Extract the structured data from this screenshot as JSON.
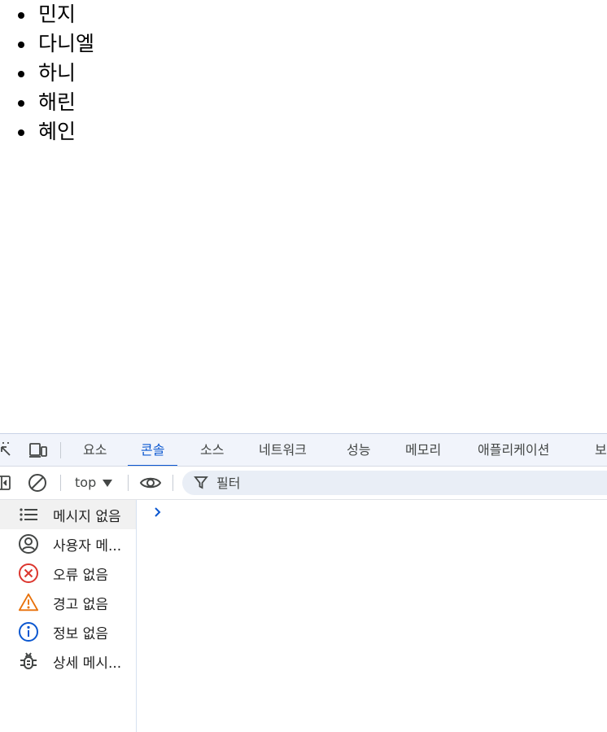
{
  "page": {
    "items": [
      "민지",
      "다니엘",
      "하니",
      "해린",
      "혜인"
    ]
  },
  "devtools": {
    "tabs": [
      {
        "label": "요소",
        "active": false
      },
      {
        "label": "콘솔",
        "active": true
      },
      {
        "label": "소스",
        "active": false
      },
      {
        "label": "네트워크",
        "active": false
      },
      {
        "label": "성능",
        "active": false
      },
      {
        "label": "메모리",
        "active": false
      },
      {
        "label": "애플리케이션",
        "active": false
      },
      {
        "label": "보",
        "active": false
      }
    ],
    "toolbar": {
      "context": "top",
      "filter_placeholder": "필터"
    },
    "sidebar": {
      "items": [
        {
          "label": "메시지 없음",
          "icon": "list-icon",
          "selected": true
        },
        {
          "label": "사용자 메...",
          "icon": "user-icon",
          "selected": false
        },
        {
          "label": "오류 없음",
          "icon": "error-icon",
          "selected": false
        },
        {
          "label": "경고 없음",
          "icon": "warning-icon",
          "selected": false
        },
        {
          "label": "정보 없음",
          "icon": "info-icon",
          "selected": false
        },
        {
          "label": "상세 메시...",
          "icon": "bug-icon",
          "selected": false
        }
      ]
    },
    "colors": {
      "accent": "#0b57d0",
      "error": "#dc362e",
      "warning": "#e8710a",
      "info": "#0b57d0"
    }
  }
}
